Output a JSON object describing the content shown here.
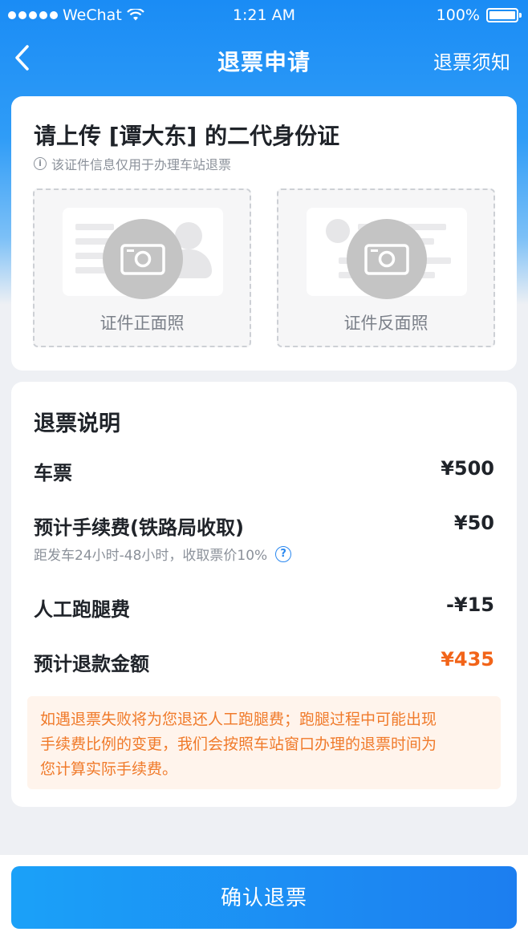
{
  "status_bar": {
    "carrier": "WeChat",
    "time": "1:21 AM",
    "battery": "100%"
  },
  "nav": {
    "title": "退票申请",
    "right_link": "退票须知"
  },
  "upload": {
    "title": "请上传 [谭大东] 的二代身份证",
    "note": "该证件信息仅用于办理车站退票",
    "front_label": "证件正面照",
    "back_label": "证件反面照"
  },
  "detail": {
    "title": "退票说明",
    "ticket_label": "车票",
    "ticket_value": "¥500",
    "fee_label": "预计手续费(铁路局收取)",
    "fee_value": "¥50",
    "fee_note": "距发车24小时-48小时，收取票价10%",
    "errand_label": "人工跑腿费",
    "errand_value": "-¥15",
    "refund_label": "预计退款金额",
    "refund_value": "¥435",
    "notice_lines": [
      "如遇退票失败将为您退还人工跑腿费；跑腿过程中可能出现",
      "手续费比例的变更，我们会按照车站窗口办理的退票时间为",
      "您计算实际手续费。"
    ]
  },
  "footer": {
    "confirm_label": "确认退票"
  },
  "colors": {
    "brand_blue": "#1c8cf5",
    "refund_orange": "#f26419",
    "notice_bg": "#fff4ec"
  }
}
